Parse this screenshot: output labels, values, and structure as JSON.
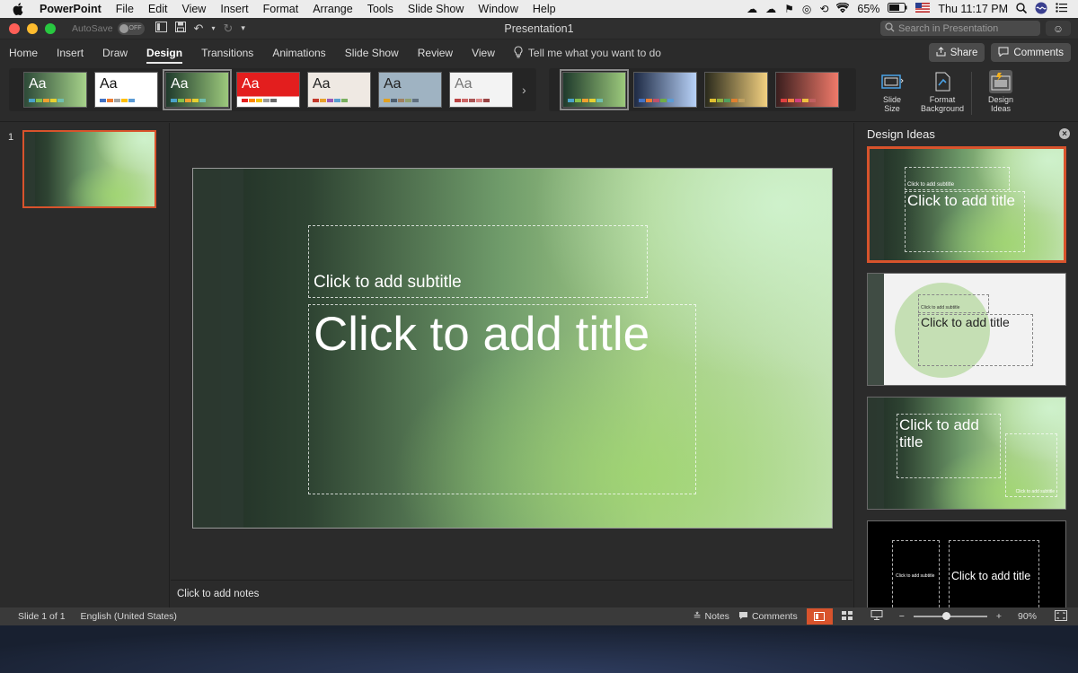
{
  "menubar": {
    "app_name": "PowerPoint",
    "items": [
      "File",
      "Edit",
      "View",
      "Insert",
      "Format",
      "Arrange",
      "Tools",
      "Slide Show",
      "Window",
      "Help"
    ],
    "battery": "65%",
    "clock": "Thu 11:17 PM"
  },
  "titlebar": {
    "autosave_label": "AutoSave",
    "autosave_state": "OFF",
    "document_title": "Presentation1",
    "search_placeholder": "Search in Presentation"
  },
  "ribbon_tabs": {
    "tabs": [
      "Home",
      "Insert",
      "Draw",
      "Design",
      "Transitions",
      "Animations",
      "Slide Show",
      "Review",
      "View"
    ],
    "active_tab": "Design",
    "tell_me": "Tell me what you want to do",
    "share_label": "Share",
    "comments_label": "Comments"
  },
  "ribbon": {
    "theme_glyph": "Aa",
    "tools": {
      "slide_size": [
        "Slide",
        "Size"
      ],
      "format_background": [
        "Format",
        "Background"
      ],
      "design_ideas": [
        "Design",
        "Ideas"
      ]
    }
  },
  "slides_panel": {
    "slide_number": "1"
  },
  "slide": {
    "subtitle_placeholder": "Click to add subtitle",
    "title_placeholder": "Click to add title"
  },
  "notes": {
    "placeholder": "Click to add notes"
  },
  "design_ideas": {
    "header": "Design Ideas",
    "idea1": {
      "subtitle": "Click to add subtitle",
      "title": "Click to add title"
    },
    "idea2": {
      "subtitle": "Click to add subtitle",
      "title": "Click to add title"
    },
    "idea3": {
      "title": "Click to add title",
      "subtitle": "Click to add subtitle"
    },
    "idea4": {
      "subtitle": "Click to add subtitle",
      "title": "Click to add title"
    }
  },
  "statusbar": {
    "slide_indicator": "Slide 1 of 1",
    "language": "English (United States)",
    "notes_label": "Notes",
    "comments_label": "Comments",
    "zoom_minus": "−",
    "zoom_plus": "+",
    "zoom_level": "90%"
  },
  "colors": {
    "accent": "#d8532c",
    "window_bg": "#2b2b2b"
  }
}
